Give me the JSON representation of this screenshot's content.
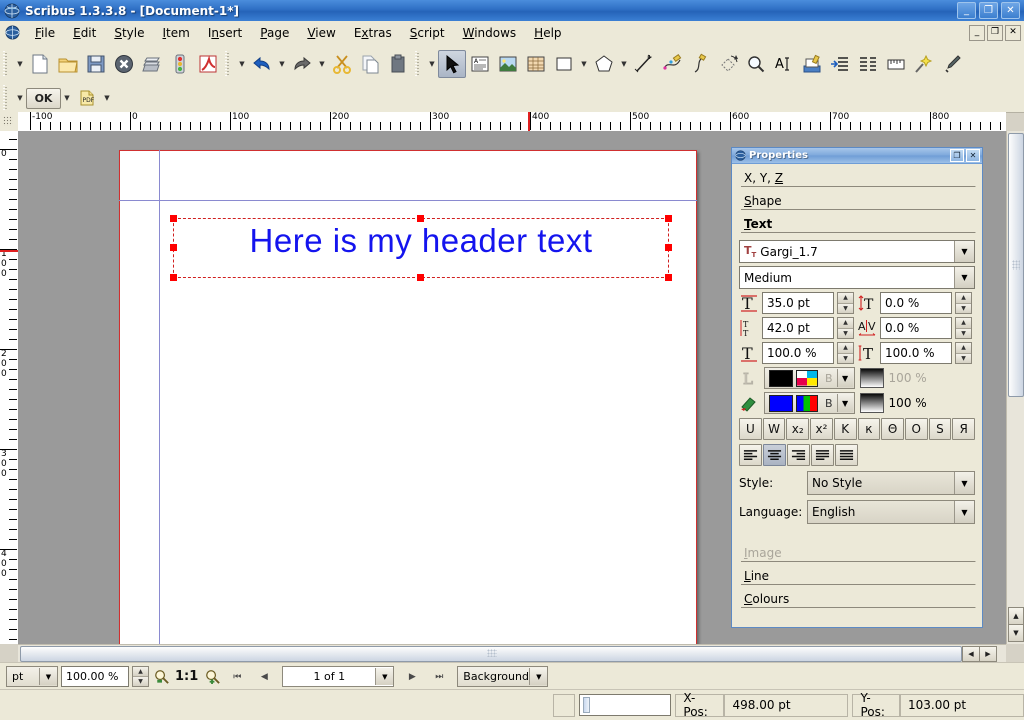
{
  "window": {
    "title": "Scribus 1.3.3.8 - [Document-1*]",
    "app_icon": "scribus-globe-icon",
    "minimize": "_",
    "maximize": "❐",
    "close": "✕"
  },
  "menubar": {
    "items": [
      {
        "pre": "",
        "hot": "F",
        "post": "ile"
      },
      {
        "pre": "",
        "hot": "E",
        "post": "dit"
      },
      {
        "pre": "",
        "hot": "S",
        "post": "tyle"
      },
      {
        "pre": "",
        "hot": "I",
        "post": "tem"
      },
      {
        "pre": "I",
        "hot": "n",
        "post": "sert"
      },
      {
        "pre": "",
        "hot": "P",
        "post": "age"
      },
      {
        "pre": "",
        "hot": "V",
        "post": "iew"
      },
      {
        "pre": "E",
        "hot": "x",
        "post": "tras"
      },
      {
        "pre": "",
        "hot": "S",
        "post": "cript"
      },
      {
        "pre": "",
        "hot": "W",
        "post": "indows"
      },
      {
        "pre": "",
        "hot": "H",
        "post": "elp"
      }
    ],
    "doc_buttons": {
      "minimize": "_",
      "restore": "❐",
      "close": "✕"
    }
  },
  "toolbar_file": {
    "icons": [
      "new-document-icon",
      "open-folder-icon",
      "save-icon",
      "close-document-icon",
      "print-icon",
      "preflight-verifier-icon",
      "export-pdf-icon"
    ],
    "undo_icon": "undo-icon",
    "redo_icon": "redo-icon",
    "cut_icon": "cut-scissors-icon",
    "copy_icon": "copy-icon",
    "paste_icon": "paste-icon"
  },
  "toolbar_tools": {
    "icons": [
      "select-arrow-icon",
      "insert-text-frame-icon",
      "insert-image-frame-icon",
      "insert-table-icon",
      "insert-shape-icon",
      "insert-polygon-icon",
      "insert-line-icon",
      "insert-bezier-curve-icon",
      "insert-freehand-line-icon",
      "rotate-item-icon",
      "zoom-icon",
      "edit-contents-icon",
      "edit-text-story-editor-icon",
      "link-text-frames-icon",
      "unlink-text-frames-icon",
      "measurements-icon",
      "copy-item-properties-icon",
      "eye-dropper-icon"
    ],
    "active_tool": "select-arrow-icon"
  },
  "toolbar_pdf": {
    "ok_label": "OK",
    "pdf_icon": "pdf-tools-icon",
    "dropdown_arrow": "▼"
  },
  "rulers": {
    "unit": "pt",
    "horizontal_labels": [
      "-100",
      "0",
      "100",
      "200",
      "300",
      "400",
      "500",
      "600",
      "700",
      "800"
    ],
    "vertical_labels": [
      "0",
      "100",
      "200",
      "300",
      "400"
    ],
    "h_marker_value": "498",
    "v_marker_value": "103"
  },
  "canvas": {
    "page_label": "Document-1",
    "text_frame": {
      "content": "Here is my header text",
      "color": "#1414ee",
      "selected": true,
      "handles": 8
    }
  },
  "properties": {
    "title": "Properties",
    "title_icon": "scribus-globe-icon",
    "undock_button": "❐",
    "close_button": "✕",
    "sections": [
      {
        "name": "xyz",
        "pre": "X, Y, ",
        "hot": "Z",
        "post": "",
        "state": "normal"
      },
      {
        "name": "shape",
        "pre": "",
        "hot": "S",
        "post": "hape",
        "state": "normal"
      },
      {
        "name": "text",
        "pre": "",
        "hot": "T",
        "post": "ext",
        "state": "current"
      }
    ],
    "bottom_sections": [
      {
        "name": "image",
        "pre": "",
        "hot": "I",
        "post": "mage",
        "state": "disabled"
      },
      {
        "name": "line",
        "pre": "",
        "hot": "L",
        "post": "ine",
        "state": "normal"
      },
      {
        "name": "colours",
        "pre": "",
        "hot": "C",
        "post": "olours",
        "state": "normal"
      }
    ],
    "font_family": "Gargi_1.7",
    "font_style": "Medium",
    "font_family_icon": "font-tt-icon",
    "fields": {
      "font_size": {
        "icon": "font-size-icon",
        "value": "35.0 pt"
      },
      "baseline_shift": {
        "icon": "baseline-shift-icon",
        "value": "0.0 %"
      },
      "line_spacing": {
        "icon": "line-spacing-icon",
        "value": "42.0 pt"
      },
      "tracking": {
        "icon": "tracking-kerning-icon",
        "value": "0.0 %"
      },
      "scale_width": {
        "icon": "scale-width-icon",
        "value": "100.0 %"
      },
      "scale_height": {
        "icon": "scale-height-icon",
        "value": "100.0 %"
      }
    },
    "stroke_color": {
      "icon": "text-stroke-icon",
      "color": "#000000",
      "swatch2": "cmyk-swatch-icon",
      "b_label": "B",
      "shade": "100 %",
      "enabled": false
    },
    "fill_color": {
      "icon": "text-fill-icon",
      "color": "#0000ff",
      "swatch2": "rgb-swatch-icon",
      "b_label": "B",
      "shade": "100 %",
      "enabled": true
    },
    "style_buttons": [
      {
        "name": "underline",
        "glyph": "U"
      },
      {
        "name": "underline-words-only",
        "glyph": "W"
      },
      {
        "name": "subscript",
        "glyph": "x₂"
      },
      {
        "name": "superscript",
        "glyph": "x²"
      },
      {
        "name": "all-caps",
        "glyph": "K"
      },
      {
        "name": "small-caps",
        "glyph": "к"
      },
      {
        "name": "strikethrough",
        "glyph": "Θ"
      },
      {
        "name": "outline",
        "glyph": "O"
      },
      {
        "name": "shadowed-text",
        "glyph": "S"
      },
      {
        "name": "mirror-text",
        "glyph": "Я"
      }
    ],
    "align_buttons": [
      {
        "name": "align-left",
        "active": false
      },
      {
        "name": "align-center",
        "active": true
      },
      {
        "name": "align-right",
        "active": false
      },
      {
        "name": "align-block",
        "active": false
      },
      {
        "name": "align-forced",
        "active": false
      }
    ],
    "style_label": "Style:",
    "style_value": "No Style",
    "language_label": "Language:",
    "language_value": "English"
  },
  "statusbar": {
    "unit": "pt",
    "zoom": "100.00 %",
    "zoom_out_icon": "zoom-out-icon",
    "zoom_reset_label": "1:1",
    "zoom_in_icon": "zoom-in-icon",
    "nav_first": "⏮",
    "nav_prev": "◀",
    "page_value": "1 of 1",
    "nav_next": "▶",
    "nav_last": "⏭",
    "layer": "Background",
    "xpos_label": "X-Pos:",
    "xpos_value": "498.00 pt",
    "ypos_label": "Y-Pos:",
    "ypos_value": "103.00 pt"
  }
}
